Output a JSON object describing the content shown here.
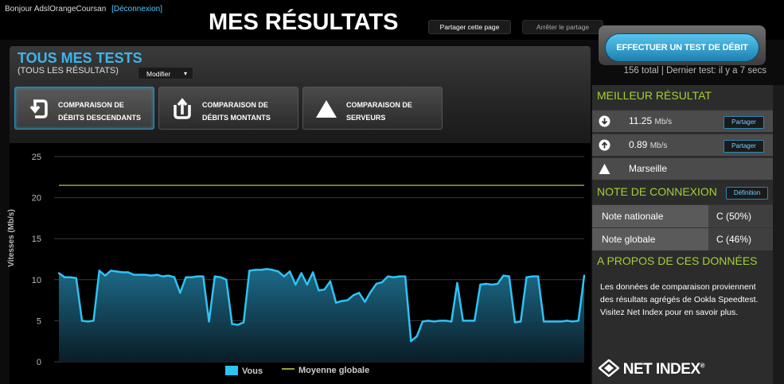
{
  "header": {
    "greeting": "Bonjour AdslOrangeCoursan",
    "logout_link": "[Déconnexion]",
    "title": "MES RÉSULTATS",
    "share_button": "Partager cette page",
    "stop_share_button": "Arrêter le partage",
    "test_button": "EFFECTUER UN TEST DE DÉBIT",
    "total_info": "156 total | Dernier test: il y a 7 secs"
  },
  "tests": {
    "title": "TOUS MES TESTS",
    "subtitle": "(TOUS LES RÉSULTATS)",
    "modify_label": "Modifier",
    "modify_caret": "▾",
    "comparisons": [
      {
        "label_line1": "COMPARAISON DE",
        "label_line2": "DÉBITS DESCENDANTS",
        "icon": "download-arrow-icon"
      },
      {
        "label_line1": "COMPARAISON DE",
        "label_line2": "DÉBITS MONTANTS",
        "icon": "upload-arrow-icon"
      },
      {
        "label_line1": "COMPARAISON DE",
        "label_line2": "SERVEURS",
        "icon": "triangle-icon"
      }
    ]
  },
  "chart_data": {
    "type": "area",
    "ylabel": "Vitesses (Mb/s)",
    "ylim": [
      0,
      25
    ],
    "yticks": [
      "0",
      "5",
      "10",
      "15",
      "20",
      "25"
    ],
    "grid": true,
    "legend_position": "bottom",
    "colors": {
      "vous": "#2ec3f5",
      "moyenne": "#8aab2e"
    },
    "series": [
      {
        "name": "Vous",
        "values": [
          10.8,
          10.3,
          10.3,
          10.2,
          5.0,
          4.9,
          5.0,
          11.1,
          10.5,
          11.1,
          11.0,
          10.9,
          10.9,
          10.6,
          10.6,
          10.6,
          10.5,
          10.6,
          10.4,
          10.5,
          10.3,
          8.4,
          10.3,
          10.3,
          10.4,
          10.4,
          4.9,
          10.4,
          10.3,
          10.0,
          4.6,
          4.5,
          4.8,
          11.1,
          11.2,
          11.2,
          11.3,
          11.2,
          11.0,
          10.4,
          11.0,
          9.4,
          10.8,
          9.4,
          10.9,
          8.7,
          8.8,
          9.8,
          7.2,
          7.4,
          7.5,
          8.1,
          8.4,
          7.3,
          8.5,
          9.5,
          9.7,
          10.4,
          10.3,
          10.4,
          10.4,
          2.5,
          3.1,
          4.9,
          5.0,
          4.9,
          5.0,
          5.0,
          4.9,
          9.6,
          5.0,
          5.0,
          5.0,
          9.4,
          9.5,
          9.4,
          9.5,
          10.5,
          10.4,
          4.8,
          4.9,
          10.3,
          10.4,
          10.4,
          4.9,
          4.9,
          4.9,
          4.9,
          5.0,
          4.9,
          5.0,
          10.5
        ]
      },
      {
        "name": "Moyenne globale",
        "values": [
          21.5,
          21.5
        ]
      }
    ]
  },
  "sidebar": {
    "best_title": "MEILLEUR RÉSULTAT",
    "download_value": "11.25",
    "download_unit": "Mb/s",
    "upload_value": "0.89",
    "upload_unit": "Mb/s",
    "server": "Marseille",
    "share_label": "Partager",
    "rating_title": "NOTE DE CONNEXION",
    "definition_label": "Définition",
    "national_label": "Note nationale",
    "national_value": "C (50%)",
    "global_label": "Note globale",
    "global_value": "C (46%)",
    "about_title": "A PROPOS DE CES DONNÉES",
    "about_text": "Les données de comparaison proviennent des résultats agrégés de Ookla Speedtest. Visitez Net Index pour en savoir plus.",
    "netindex_logo": "NET INDEX",
    "netindex_mark": "®"
  }
}
